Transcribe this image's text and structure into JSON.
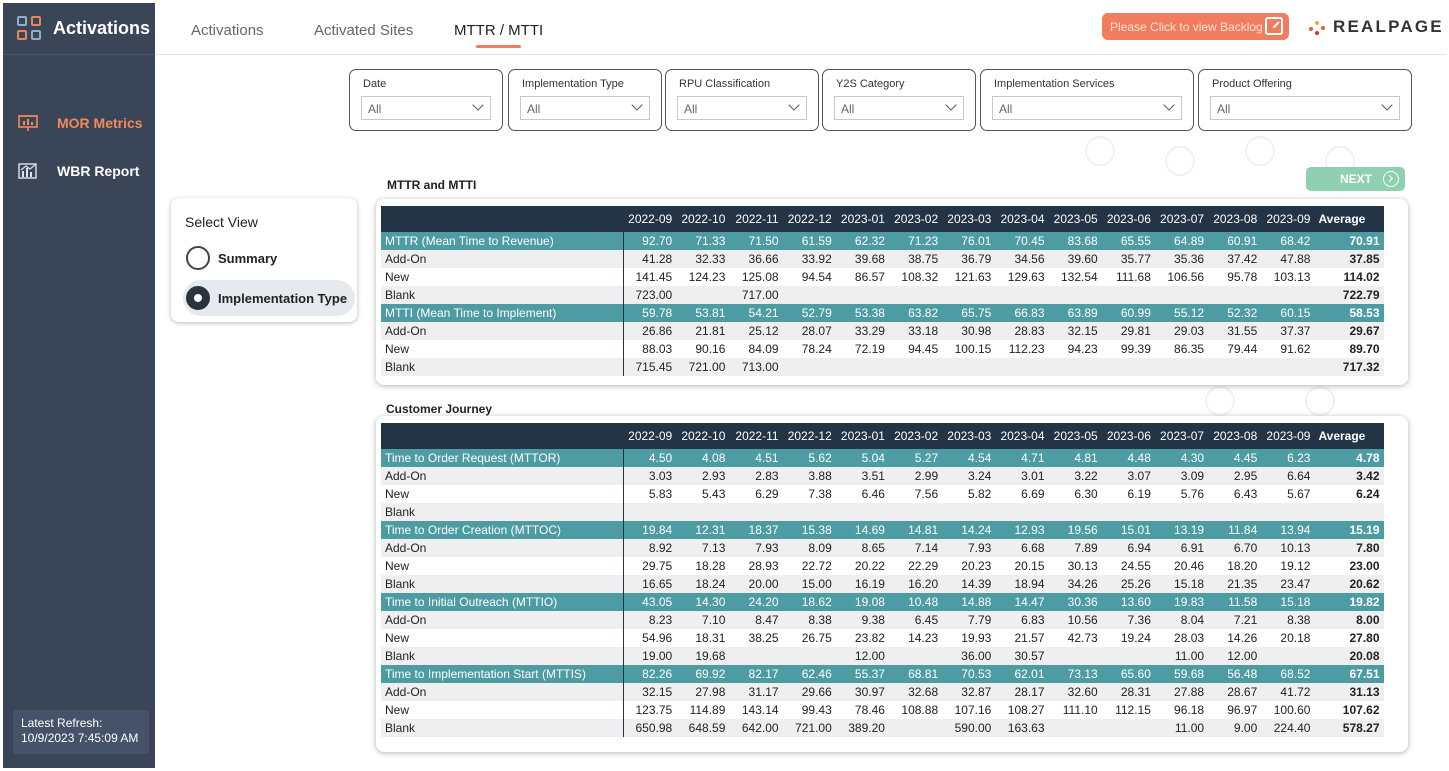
{
  "app": {
    "title": "Activations"
  },
  "sidebar": {
    "items": [
      {
        "label": "MOR Metrics",
        "icon": "presentation-chart-icon",
        "color": "#f08a5d"
      },
      {
        "label": "WBR Report",
        "icon": "bar-chart-icon",
        "color": "#ffffff"
      }
    ],
    "refresh_label": "Latest Refresh:",
    "refresh_value": "10/9/2023 7:45:09 AM"
  },
  "tabs": [
    {
      "label": "Activations"
    },
    {
      "label": "Activated Sites"
    },
    {
      "label": "MTTR / MTTI",
      "active": true
    }
  ],
  "backlog_button": {
    "label": "Please Click to view Backlog",
    "icon": "external-link-icon",
    "color": "#f07e5e"
  },
  "brand": {
    "logo_text": "REALPAGE"
  },
  "filters": [
    {
      "label": "Date",
      "value": "All"
    },
    {
      "label": "Implementation Type",
      "value": "All"
    },
    {
      "label": "RPU Classification",
      "value": "All"
    },
    {
      "label": "Y2S Category",
      "value": "All"
    },
    {
      "label": "Implementation Services",
      "value": "All"
    },
    {
      "label": "Product Offering",
      "value": "All"
    }
  ],
  "select_view": {
    "title": "Select View",
    "options": [
      {
        "label": "Summary",
        "selected": false
      },
      {
        "label": "Implementation Type",
        "selected": true
      }
    ]
  },
  "next_button": {
    "label": "NEXT",
    "color": "#8fd0b0"
  },
  "colors": {
    "header": "#243447",
    "group_row": "#4d9ca3",
    "sidebar": "#3a4558",
    "accent": "#ef7e5e"
  },
  "columns": [
    "2022-09",
    "2022-10",
    "2022-11",
    "2022-12",
    "2023-01",
    "2023-02",
    "2023-03",
    "2023-04",
    "2023-05",
    "2023-06",
    "2023-07",
    "2023-08",
    "2023-09",
    "Average"
  ],
  "mttr_table": {
    "title": "MTTR and MTTI",
    "rows": [
      {
        "label": "MTTR (Mean Time to Revenue)",
        "group": true,
        "values": [
          "92.70",
          "71.33",
          "71.50",
          "61.59",
          "62.32",
          "71.23",
          "76.01",
          "70.45",
          "83.68",
          "65.55",
          "64.89",
          "60.91",
          "68.42",
          "70.91"
        ]
      },
      {
        "label": "Add-On",
        "values": [
          "41.28",
          "32.33",
          "36.66",
          "33.92",
          "39.68",
          "38.75",
          "36.79",
          "34.56",
          "39.60",
          "35.77",
          "35.36",
          "37.42",
          "47.88",
          "37.85"
        ]
      },
      {
        "label": "New",
        "values": [
          "141.45",
          "124.23",
          "125.08",
          "94.54",
          "86.57",
          "108.32",
          "121.63",
          "129.63",
          "132.54",
          "111.68",
          "106.56",
          "95.78",
          "103.13",
          "114.02"
        ]
      },
      {
        "label": "Blank",
        "values": [
          "723.00",
          "",
          "717.00",
          "",
          "",
          "",
          "",
          "",
          "",
          "",
          "",
          "",
          "",
          "722.79"
        ]
      },
      {
        "label": "MTTI (Mean Time to Implement)",
        "group": true,
        "values": [
          "59.78",
          "53.81",
          "54.21",
          "52.79",
          "53.38",
          "63.82",
          "65.75",
          "66.83",
          "63.89",
          "60.99",
          "55.12",
          "52.32",
          "60.15",
          "58.53"
        ]
      },
      {
        "label": "Add-On",
        "values": [
          "26.86",
          "21.81",
          "25.12",
          "28.07",
          "33.29",
          "33.18",
          "30.98",
          "28.83",
          "32.15",
          "29.81",
          "29.03",
          "31.55",
          "37.37",
          "29.67"
        ]
      },
      {
        "label": "New",
        "values": [
          "88.03",
          "90.16",
          "84.09",
          "78.24",
          "72.19",
          "94.45",
          "100.15",
          "112.23",
          "94.23",
          "99.39",
          "86.35",
          "79.44",
          "91.62",
          "89.70"
        ]
      },
      {
        "label": "Blank",
        "values": [
          "715.45",
          "721.00",
          "713.00",
          "",
          "",
          "",
          "",
          "",
          "",
          "",
          "",
          "",
          "",
          "717.32"
        ]
      }
    ]
  },
  "journey_table": {
    "title": "Customer Journey",
    "rows": [
      {
        "label": "Time to Order Request (MTTOR)",
        "group": true,
        "values": [
          "4.50",
          "4.08",
          "4.51",
          "5.62",
          "5.04",
          "5.27",
          "4.54",
          "4.71",
          "4.81",
          "4.48",
          "4.30",
          "4.45",
          "6.23",
          "4.78"
        ]
      },
      {
        "label": "Add-On",
        "values": [
          "3.03",
          "2.93",
          "2.83",
          "3.88",
          "3.51",
          "2.99",
          "3.24",
          "3.01",
          "3.22",
          "3.07",
          "3.09",
          "2.95",
          "6.64",
          "3.42"
        ]
      },
      {
        "label": "New",
        "values": [
          "5.83",
          "5.43",
          "6.29",
          "7.38",
          "6.46",
          "7.56",
          "5.82",
          "6.69",
          "6.30",
          "6.19",
          "5.76",
          "6.43",
          "5.67",
          "6.24"
        ]
      },
      {
        "label": "Blank",
        "values": [
          "",
          "",
          "",
          "",
          "",
          "",
          "",
          "",
          "",
          "",
          "",
          "",
          "",
          ""
        ]
      },
      {
        "label": "Time to Order Creation (MTTOC)",
        "group": true,
        "values": [
          "19.84",
          "12.31",
          "18.37",
          "15.38",
          "14.69",
          "14.81",
          "14.24",
          "12.93",
          "19.56",
          "15.01",
          "13.19",
          "11.84",
          "13.94",
          "15.19"
        ]
      },
      {
        "label": "Add-On",
        "values": [
          "8.92",
          "7.13",
          "7.93",
          "8.09",
          "8.65",
          "7.14",
          "7.93",
          "6.68",
          "7.89",
          "6.94",
          "6.91",
          "6.70",
          "10.13",
          "7.80"
        ]
      },
      {
        "label": "New",
        "values": [
          "29.75",
          "18.28",
          "28.93",
          "22.72",
          "20.22",
          "22.29",
          "20.23",
          "20.15",
          "30.13",
          "24.55",
          "20.46",
          "18.20",
          "19.12",
          "23.00"
        ]
      },
      {
        "label": "Blank",
        "values": [
          "16.65",
          "18.24",
          "20.00",
          "15.00",
          "16.19",
          "16.20",
          "14.39",
          "18.94",
          "34.26",
          "25.26",
          "15.18",
          "21.35",
          "23.47",
          "20.62"
        ]
      },
      {
        "label": "Time to Initial Outreach (MTTIO)",
        "group": true,
        "values": [
          "43.05",
          "14.30",
          "24.20",
          "18.62",
          "19.08",
          "10.48",
          "14.88",
          "14.47",
          "30.36",
          "13.60",
          "19.83",
          "11.58",
          "15.18",
          "19.82"
        ]
      },
      {
        "label": "Add-On",
        "values": [
          "8.23",
          "7.10",
          "8.47",
          "8.38",
          "9.38",
          "6.45",
          "7.79",
          "6.83",
          "10.56",
          "7.36",
          "8.04",
          "7.21",
          "8.38",
          "8.00"
        ]
      },
      {
        "label": "New",
        "values": [
          "54.96",
          "18.31",
          "38.25",
          "26.75",
          "23.82",
          "14.23",
          "19.93",
          "21.57",
          "42.73",
          "19.24",
          "28.03",
          "14.26",
          "20.18",
          "27.80"
        ]
      },
      {
        "label": "Blank",
        "values": [
          "19.00",
          "19.68",
          "",
          "",
          "12.00",
          "",
          "36.00",
          "30.57",
          "",
          "",
          "11.00",
          "12.00",
          "",
          "20.08"
        ]
      },
      {
        "label": "Time to Implementation Start (MTTIS)",
        "group": true,
        "values": [
          "82.26",
          "69.92",
          "82.17",
          "62.46",
          "55.37",
          "68.81",
          "70.53",
          "62.01",
          "73.13",
          "65.60",
          "59.68",
          "56.48",
          "68.52",
          "67.51"
        ]
      },
      {
        "label": "Add-On",
        "values": [
          "32.15",
          "27.98",
          "31.17",
          "29.66",
          "30.97",
          "32.68",
          "32.87",
          "28.17",
          "32.60",
          "28.31",
          "27.88",
          "28.67",
          "41.72",
          "31.13"
        ]
      },
      {
        "label": "New",
        "values": [
          "123.75",
          "114.89",
          "143.14",
          "99.43",
          "78.46",
          "108.88",
          "107.16",
          "108.27",
          "111.10",
          "112.15",
          "96.18",
          "96.97",
          "100.60",
          "107.62"
        ]
      },
      {
        "label": "Blank",
        "values": [
          "650.98",
          "648.59",
          "642.00",
          "721.00",
          "389.20",
          "",
          "590.00",
          "163.63",
          "",
          "",
          "11.00",
          "9.00",
          "224.40",
          "578.27"
        ]
      }
    ]
  }
}
